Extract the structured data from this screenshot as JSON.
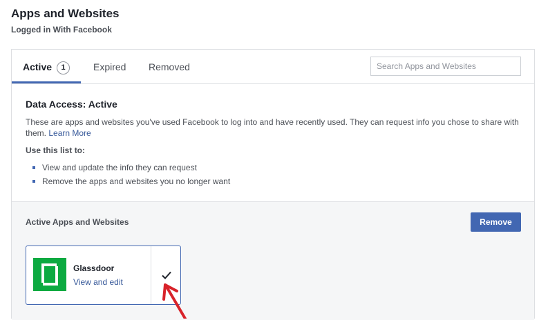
{
  "header": {
    "title": "Apps and Websites",
    "subtitle": "Logged in With Facebook"
  },
  "tabs": [
    {
      "label": "Active",
      "badge": "1",
      "active": true
    },
    {
      "label": "Expired",
      "active": false
    },
    {
      "label": "Removed",
      "active": false
    }
  ],
  "search": {
    "placeholder": "Search Apps and Websites",
    "value": ""
  },
  "info": {
    "title": "Data Access: Active",
    "description": "These are apps and websites you've used Facebook to log into and have recently used. They can request info you chose to share with them.",
    "learn_more": "Learn More",
    "use_title": "Use this list to:",
    "bullets": [
      "View and update the info they can request",
      "Remove the apps and websites you no longer want"
    ]
  },
  "active_section": {
    "title": "Active Apps and Websites",
    "remove_label": "Remove"
  },
  "apps": [
    {
      "name": "Glassdoor",
      "action": "View and edit",
      "checked": true,
      "logo_color": "#0caa41",
      "icon": "glassdoor-logo"
    }
  ],
  "colors": {
    "accent": "#4267b2",
    "link": "#365899",
    "annotation_arrow": "#d8232a"
  }
}
